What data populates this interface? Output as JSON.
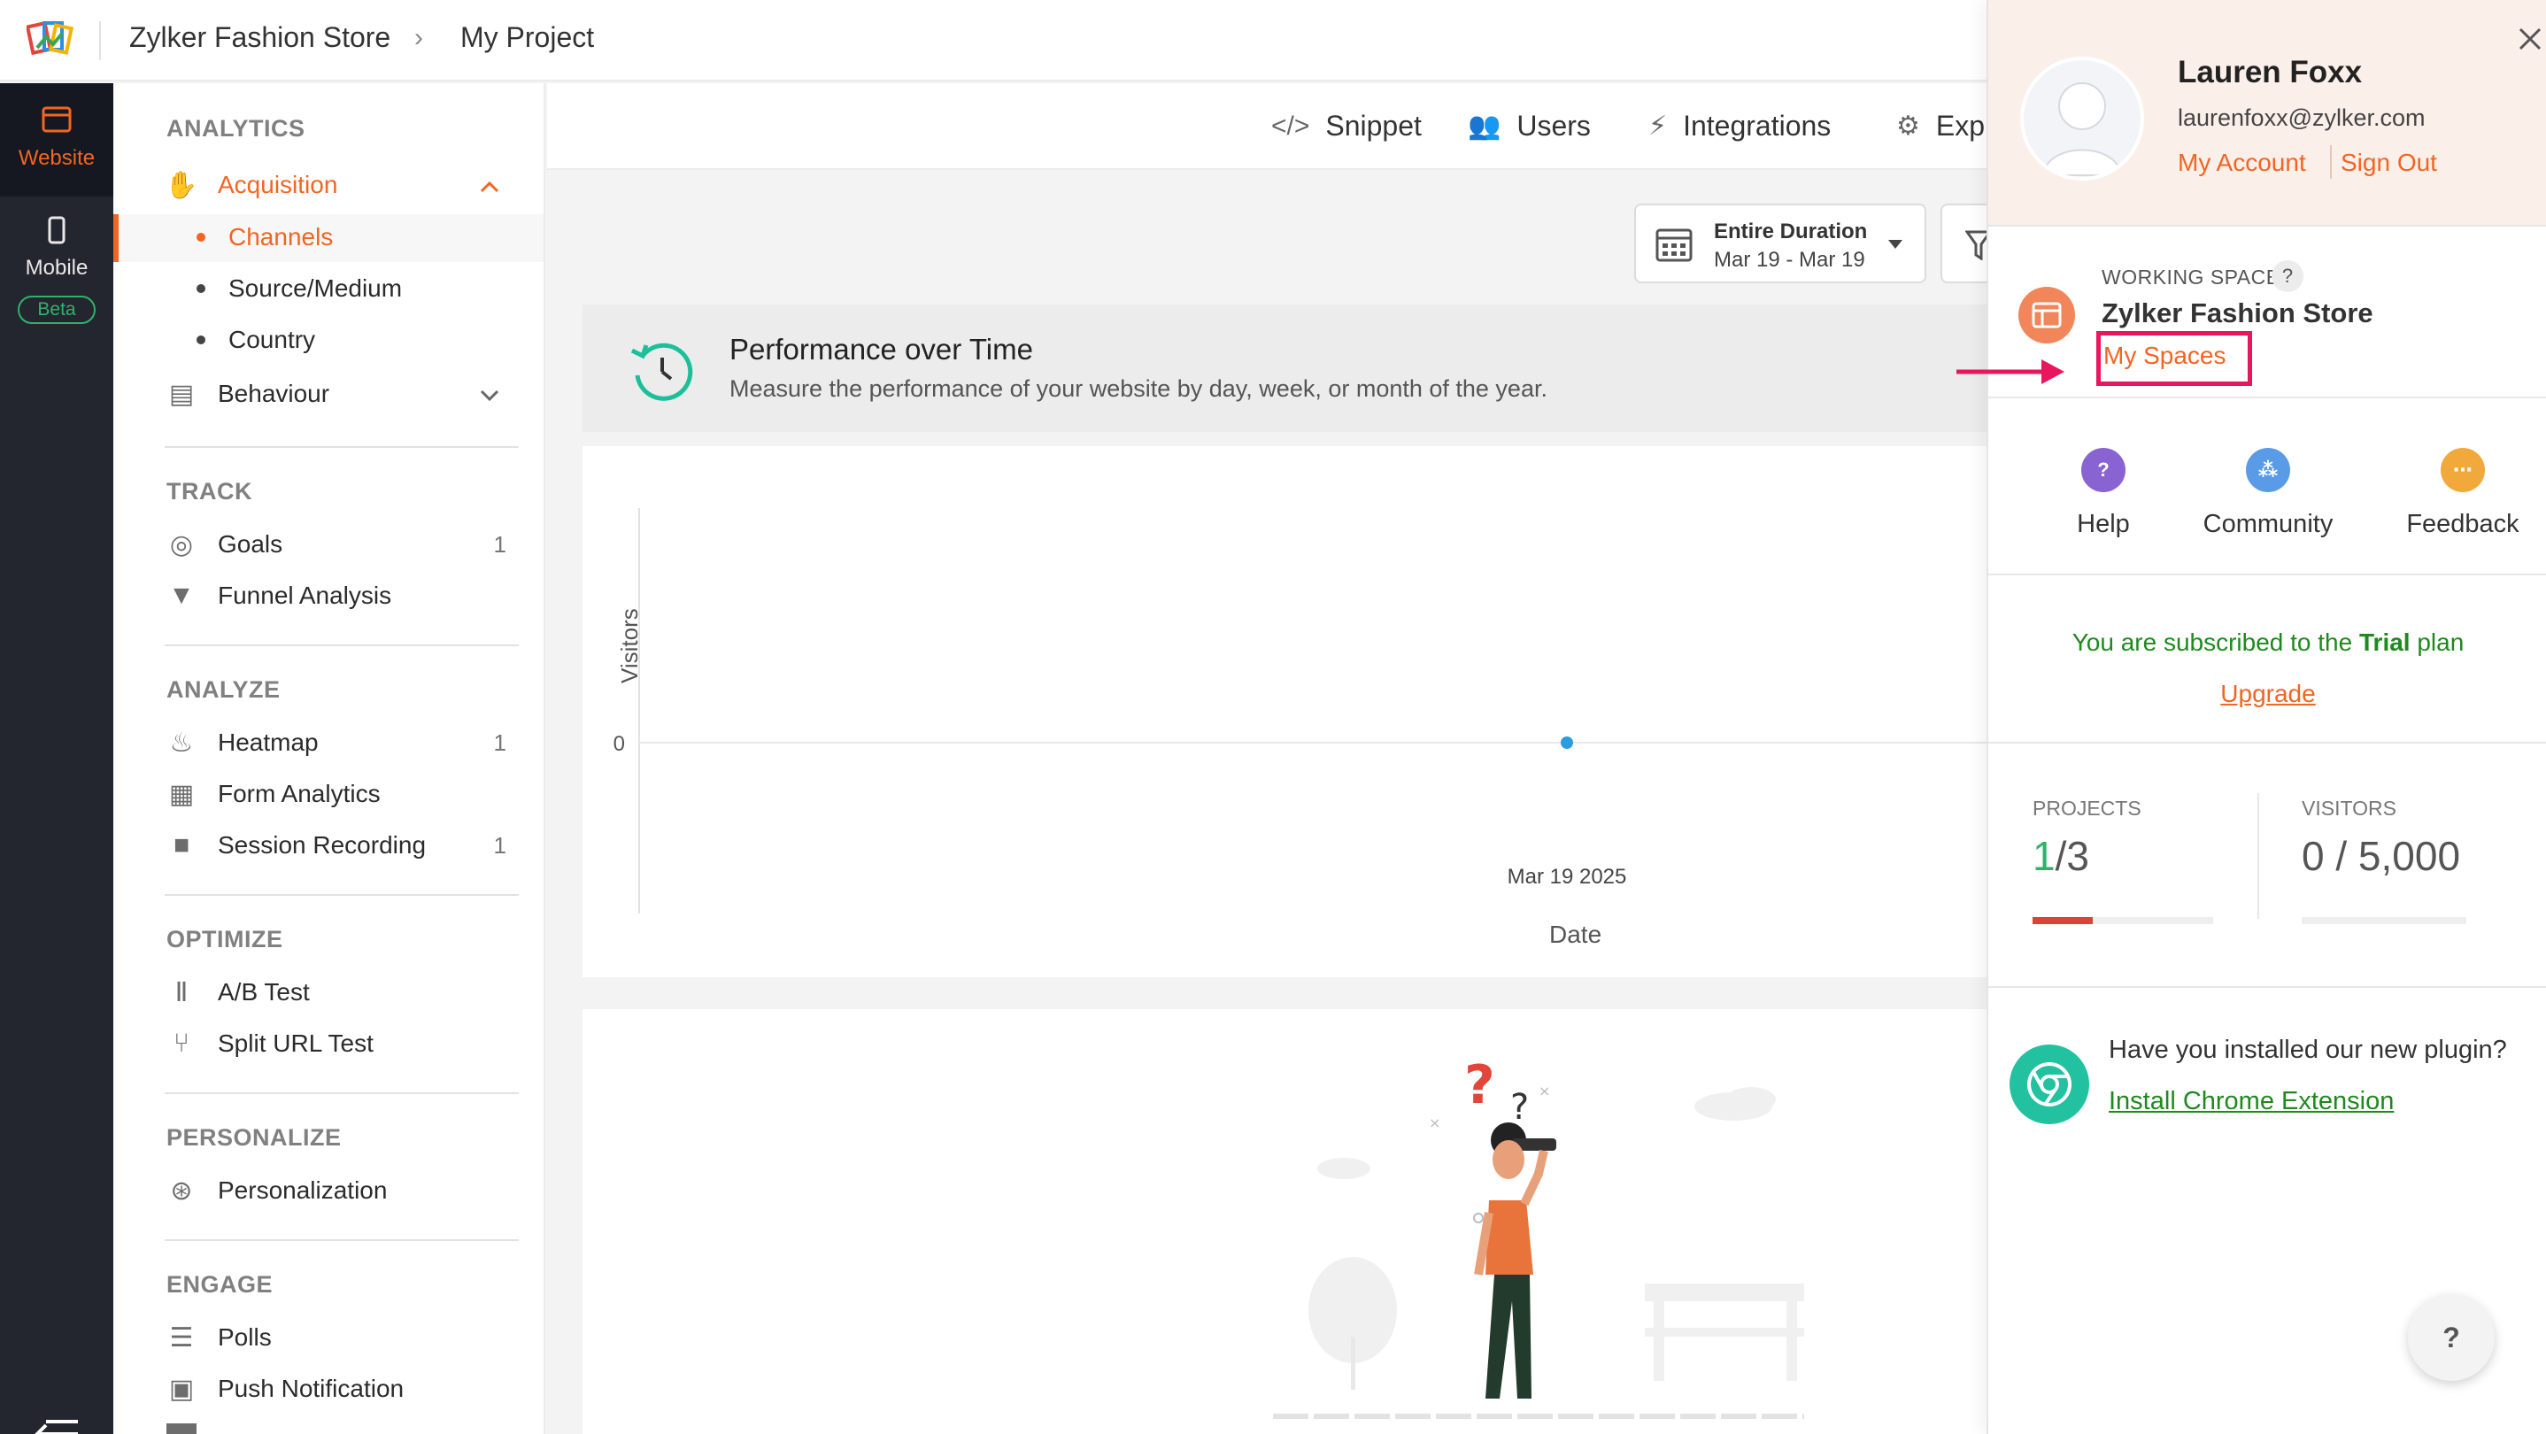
{
  "breadcrumb": {
    "store": "Zylker Fashion Store",
    "project": "My Project"
  },
  "rail": {
    "website_label": "Website",
    "mobile_label": "Mobile",
    "beta_label": "Beta"
  },
  "nav": {
    "analytics_header": "ANALYTICS",
    "acquisition": "Acquisition",
    "channels": "Channels",
    "source_medium": "Source/Medium",
    "country": "Country",
    "behaviour": "Behaviour",
    "track_header": "TRACK",
    "goals": "Goals",
    "goals_count": "1",
    "funnel": "Funnel Analysis",
    "analyze_header": "ANALYZE",
    "heatmap": "Heatmap",
    "heatmap_count": "1",
    "form_analytics": "Form Analytics",
    "session_recording": "Session Recording",
    "session_count": "1",
    "optimize_header": "OPTIMIZE",
    "ab_test": "A/B Test",
    "split_url": "Split URL Test",
    "personalize_header": "PERSONALIZE",
    "personalization": "Personalization",
    "engage_header": "ENGAGE",
    "polls": "Polls",
    "push": "Push Notification"
  },
  "tabs": {
    "snippet": "Snippet",
    "users": "Users",
    "integrations": "Integrations",
    "export": "Exp"
  },
  "duration": {
    "label": "Entire Duration",
    "range": "Mar 19 - Mar 19"
  },
  "performance": {
    "title": "Performance over Time",
    "subtitle": "Measure the performance of your website by day, week, or month of the year."
  },
  "chart_data": {
    "type": "line",
    "x": [
      "Mar 19 2025"
    ],
    "series": [
      {
        "values": [
          0
        ]
      }
    ],
    "xlabel": "Date",
    "ylabel": "Visitors",
    "yticks": [
      "0"
    ]
  },
  "panel": {
    "name": "Lauren Foxx",
    "email": "laurenfoxx@zylker.com",
    "my_account": "My Account",
    "sign_out": "Sign Out",
    "ws_header": "WORKING SPACE",
    "ws_help": "?",
    "ws_name": "Zylker Fashion Store",
    "my_spaces": "My Spaces",
    "help": "Help",
    "help_glyph": "?",
    "community": "Community",
    "feedback": "Feedback",
    "trial_prefix": "You are subscribed to the ",
    "trial_plan": "Trial",
    "trial_suffix": " plan",
    "upgrade": "Upgrade",
    "projects_label": "PROJECTS",
    "projects_used": "1",
    "projects_total": "/3",
    "projects_fraction": 0.333,
    "visitors_label": "VISITORS",
    "visitors_value": "0 / 5,000",
    "visitors_fraction": 0,
    "plugin_q": "Have you installed our new plugin?",
    "plugin_link": "Install Chrome Extension",
    "fab": "?"
  },
  "colors": {
    "accent": "#f26522",
    "highlight": "#e8175d",
    "green": "#2fb36a",
    "trial_green": "#1e8a1e"
  }
}
